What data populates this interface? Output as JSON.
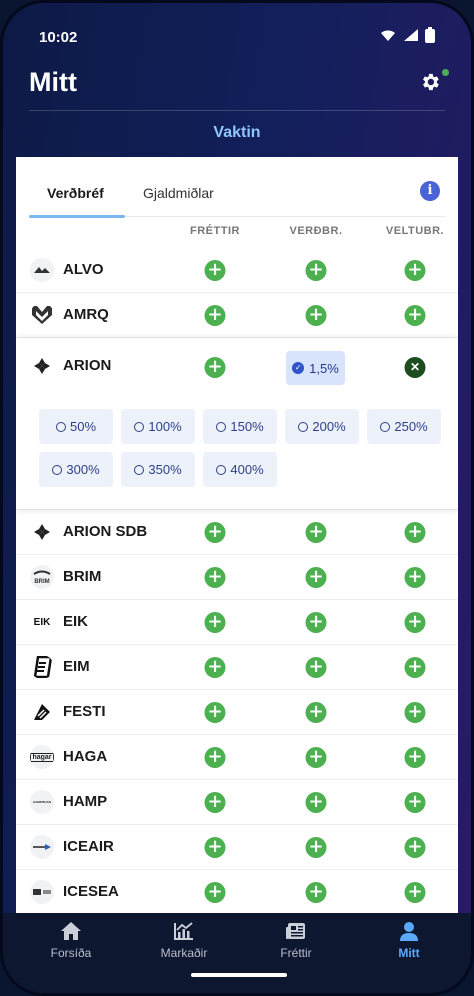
{
  "status": {
    "time": "10:02"
  },
  "header": {
    "title": "Mitt",
    "section": "Vaktin"
  },
  "tabs": [
    {
      "label": "Verðbréf",
      "active": true
    },
    {
      "label": "Gjaldmiðlar",
      "active": false
    }
  ],
  "columns": [
    "FRÉTTIR",
    "VERÐBR.",
    "VELTUBR."
  ],
  "rows": [
    {
      "ticker": "ALVO",
      "logo": "alvo-logo"
    },
    {
      "ticker": "AMRQ",
      "logo": "amrq-logo"
    },
    {
      "ticker": "ARION",
      "logo": "arion-logo",
      "expanded": true,
      "selected_threshold": "1,5%",
      "threshold_options": [
        "50%",
        "100%",
        "150%",
        "200%",
        "250%",
        "300%",
        "350%",
        "400%"
      ]
    },
    {
      "ticker": "ARION SDB",
      "logo": "arion-logo"
    },
    {
      "ticker": "BRIM",
      "logo": "brim-logo",
      "logo_text": "BRIM"
    },
    {
      "ticker": "EIK",
      "logo": "eik-logo",
      "logo_text": "EIK"
    },
    {
      "ticker": "EIM",
      "logo": "eim-logo"
    },
    {
      "ticker": "FESTI",
      "logo": "festi-logo"
    },
    {
      "ticker": "HAGA",
      "logo": "haga-logo",
      "logo_text": "hagar"
    },
    {
      "ticker": "HAMP",
      "logo": "hamp-logo",
      "logo_text": "HAMPIDJAN"
    },
    {
      "ticker": "ICEAIR",
      "logo": "iceair-logo"
    },
    {
      "ticker": "ICESEA",
      "logo": "icesea-logo"
    }
  ],
  "nav": [
    {
      "label": "Forsíða",
      "icon": "home-icon"
    },
    {
      "label": "Markaðir",
      "icon": "chart-icon"
    },
    {
      "label": "Fréttir",
      "icon": "newspaper-icon"
    },
    {
      "label": "Mitt",
      "icon": "user-icon",
      "active": true
    }
  ],
  "colors": {
    "accent": "#4caf50",
    "selected": "#d8e4fb",
    "nav_active": "#5aa9ff"
  }
}
